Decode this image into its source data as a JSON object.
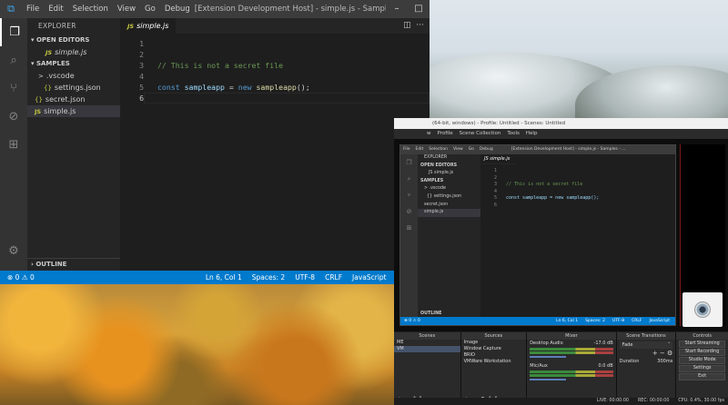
{
  "vscode": {
    "menu": [
      "File",
      "Edit",
      "Selection",
      "View",
      "Go",
      "Debug"
    ],
    "window_title": "[Extension Development Host] - simple.js - Samples - ...",
    "sidebar": {
      "title": "EXPLORER",
      "open_editors_label": "OPEN EDITORS",
      "open_editor_file": "simple.js",
      "workspace_label": "SAMPLES",
      "tree": [
        {
          "label": ".vscode",
          "badge": ">"
        },
        {
          "label": "settings.json",
          "badge": "{}"
        },
        {
          "label": "secret.json",
          "badge": "{}"
        },
        {
          "label": "simple.js",
          "badge": "JS"
        }
      ],
      "outline_label": "OUTLINE"
    },
    "tab": {
      "label": "simple.js",
      "badge": "JS"
    },
    "code": {
      "line_numbers": [
        "1",
        "2",
        "3",
        "4",
        "5",
        "6"
      ],
      "comment": "// This is not a secret file",
      "kw_const": "const",
      "var_name": "sampleapp",
      "op_eq": " = ",
      "kw_new": "new",
      "fn_call": "sampleapp",
      "tail": "();"
    },
    "status": {
      "errors": "0",
      "warnings": "0",
      "position": "Ln 6, Col 1",
      "spaces": "Spaces: 2",
      "encoding": "UTF-8",
      "eol": "CRLF",
      "language": "JavaScript"
    }
  },
  "obs": {
    "title": "(64-bit, windows) - Profile: Untitled - Scenes: Untitled",
    "menu": [
      "w",
      "Profile",
      "Scene Collection",
      "Tools",
      "Help"
    ],
    "preview": {
      "menu": [
        "File",
        "Edit",
        "Selection",
        "View",
        "Go",
        "Debug"
      ],
      "title": "[Extension Development Host] - simple.js - Samples - ...",
      "sidebar": [
        "EXPLORER",
        "OPEN EDITORS",
        "JS simple.js",
        "SAMPLES",
        "> .vscode",
        "{} settings.json",
        "secret.json",
        "simple.js",
        "OUTLINE"
      ],
      "tab": "JS simple.js",
      "lines": [
        "1",
        "2",
        "3",
        "4",
        "5",
        "6"
      ],
      "comment": "// This is not a secret file",
      "code_line": "const sampleapp = new sampleapp();",
      "status_left": "⊗ 0 ⚠ 0",
      "status_right": [
        "Ln 6, Col 1",
        "Spaces: 2",
        "UTF-8",
        "CRLF",
        "JavaScript"
      ]
    },
    "scenes": {
      "header": "Scenes",
      "items": [
        "ME",
        "VM"
      ]
    },
    "sources": {
      "header": "Sources",
      "items": [
        "Image",
        "Window Capture",
        "BRIO",
        "VMWare Workstation"
      ]
    },
    "mixer": {
      "header": "Mixer",
      "channels": [
        {
          "name": "Desktop Audio",
          "level": "-17.0 dB"
        },
        {
          "name": "Mic/Aux",
          "level": "0.0 dB"
        }
      ]
    },
    "transitions": {
      "header": "Scene Transitions",
      "type": "Fade",
      "duration_label": "Duration",
      "duration": "300ms"
    },
    "controls": {
      "header": "Controls",
      "buttons": [
        "Start Streaming",
        "Start Recording",
        "Studio Mode",
        "Settings",
        "Exit"
      ]
    },
    "statusbar": [
      "LIVE: 00:00:00",
      "REC: 00:00:00",
      "CPU: 0.4%, 30.00 fps"
    ]
  }
}
